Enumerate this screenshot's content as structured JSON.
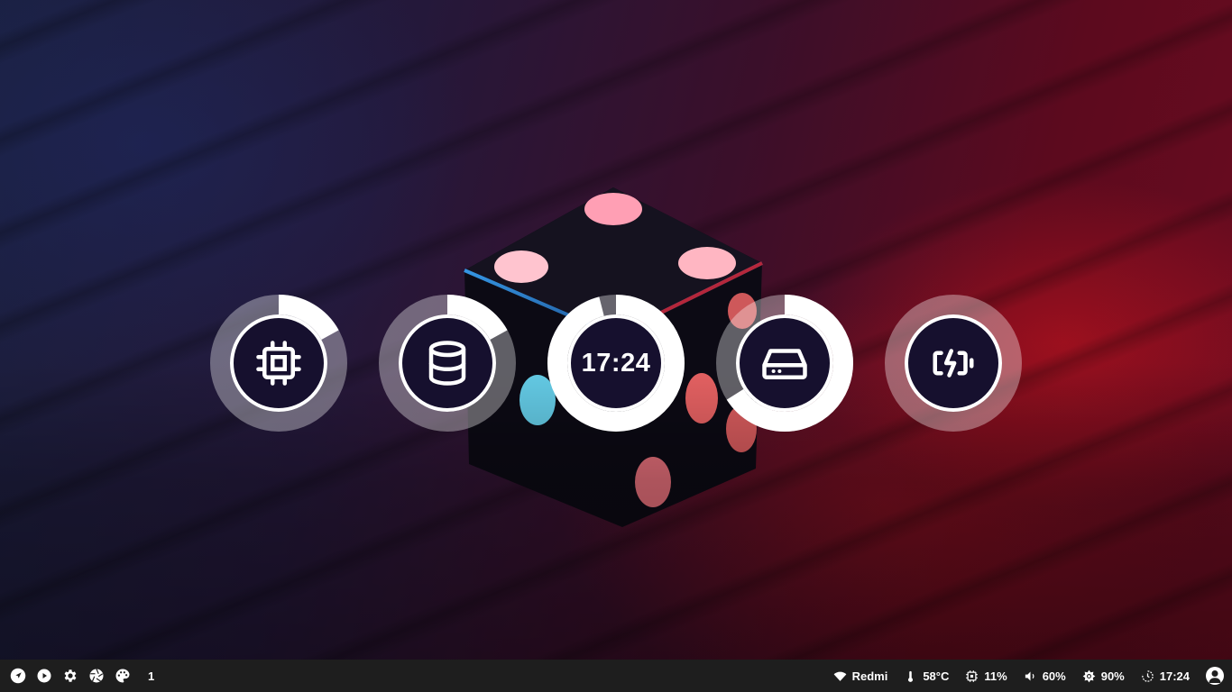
{
  "desktop": {
    "widgets": [
      {
        "name": "cpu",
        "icon": "cpu-icon",
        "progress": 0.17
      },
      {
        "name": "memory",
        "icon": "database-icon",
        "progress": 0.17
      },
      {
        "name": "clock",
        "text": "17:24",
        "progress": 0.96
      },
      {
        "name": "disk",
        "icon": "harddrive-icon",
        "progress": 0.66
      },
      {
        "name": "battery",
        "icon": "battery-charging-icon",
        "progress": 0.0
      }
    ]
  },
  "taskbar": {
    "left": {
      "icons": [
        "launcher-icon",
        "play-icon",
        "settings-icon",
        "aperture-icon",
        "palette-icon"
      ],
      "workspace": "1"
    },
    "right": {
      "wifi": "Redmi",
      "temperature": "58°C",
      "cpu": "11%",
      "volume": "60%",
      "brightness": "90%",
      "time": "17:24"
    }
  },
  "colors": {
    "taskbar_bg": "#1e1e1e",
    "widget_inner": "#16102e",
    "ring_track": "rgba(255,255,255,0.35)",
    "ring_fill": "#ffffff"
  }
}
